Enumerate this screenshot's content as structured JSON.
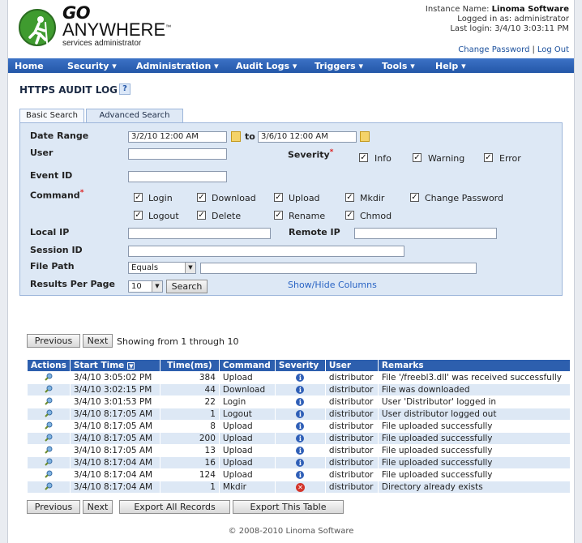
{
  "header": {
    "logo_go": "GO",
    "logo_anywhere": "ANYWHERE",
    "logo_trademark": "™",
    "logo_sub": "services administrator",
    "instance_label": "Instance Name:",
    "instance_name": "Linoma Software",
    "logged_in": "Logged in as: administrator",
    "last_login": "Last login: 3/4/10 3:03:11 PM",
    "change_password": "Change Password",
    "logout": "Log Out",
    "separator": "|"
  },
  "nav": {
    "items": [
      {
        "label": "Home"
      },
      {
        "label": "Security ▾"
      },
      {
        "label": "Administration ▾"
      },
      {
        "label": "Audit Logs ▾"
      },
      {
        "label": "Triggers ▾"
      },
      {
        "label": "Tools ▾"
      },
      {
        "label": "Help ▾"
      }
    ]
  },
  "page": {
    "title": "HTTPS AUDIT LOG",
    "help": "?"
  },
  "tabs": {
    "basic": "Basic Search",
    "advanced": "Advanced Search"
  },
  "search": {
    "date_range_label": "Date Range",
    "date_from": "3/2/10 12:00 AM",
    "to_label": "to",
    "date_to": "3/6/10 12:00 AM",
    "user_label": "User",
    "user_value": "",
    "severity_label": "Severity",
    "required_mark": "*",
    "severity_options": [
      {
        "label": "Info",
        "checked": true
      },
      {
        "label": "Warning",
        "checked": true
      },
      {
        "label": "Error",
        "checked": true
      }
    ],
    "event_id_label": "Event ID",
    "event_id_value": "",
    "command_label": "Command",
    "commands_row1": [
      {
        "label": "Login",
        "checked": true
      },
      {
        "label": "Download",
        "checked": true
      },
      {
        "label": "Upload",
        "checked": true
      },
      {
        "label": "Mkdir",
        "checked": true
      },
      {
        "label": "Change Password",
        "checked": true
      }
    ],
    "commands_row2": [
      {
        "label": "Logout",
        "checked": true
      },
      {
        "label": "Delete",
        "checked": true
      },
      {
        "label": "Rename",
        "checked": true
      },
      {
        "label": "Chmod",
        "checked": true
      }
    ],
    "local_ip_label": "Local IP",
    "local_ip_value": "",
    "remote_ip_label": "Remote IP",
    "remote_ip_value": "",
    "session_id_label": "Session ID",
    "session_id_value": "",
    "file_path_label": "File Path",
    "file_path_match": "Equals",
    "file_path_value": "",
    "results_per_page_label": "Results Per Page",
    "results_per_page": "10",
    "search_button": "Search",
    "show_hide_columns": "Show/Hide Columns"
  },
  "pager_top": {
    "previous": "Previous",
    "next": "Next",
    "showing": "Showing from 1 through 10"
  },
  "table": {
    "columns": [
      "Actions",
      "Start Time",
      "Time(ms)",
      "Command",
      "Severity",
      "User",
      "Remarks"
    ],
    "rows": [
      {
        "start": "3/4/10 3:05:02 PM",
        "ms": "384",
        "command": "Upload",
        "severity": "info",
        "user": "distributor",
        "remarks": "File '/freebl3.dll' was received successfully"
      },
      {
        "start": "3/4/10 3:02:15 PM",
        "ms": "44",
        "command": "Download",
        "severity": "info",
        "user": "distributor",
        "remarks": "File was downloaded"
      },
      {
        "start": "3/4/10 3:01:53 PM",
        "ms": "22",
        "command": "Login",
        "severity": "info",
        "user": "distributor",
        "remarks": "User 'Distributor' logged in"
      },
      {
        "start": "3/4/10 8:17:05 AM",
        "ms": "1",
        "command": "Logout",
        "severity": "info",
        "user": "distributor",
        "remarks": "User distributor logged out"
      },
      {
        "start": "3/4/10 8:17:05 AM",
        "ms": "8",
        "command": "Upload",
        "severity": "info",
        "user": "distributor",
        "remarks": "File uploaded successfully"
      },
      {
        "start": "3/4/10 8:17:05 AM",
        "ms": "200",
        "command": "Upload",
        "severity": "info",
        "user": "distributor",
        "remarks": "File uploaded successfully"
      },
      {
        "start": "3/4/10 8:17:05 AM",
        "ms": "13",
        "command": "Upload",
        "severity": "info",
        "user": "distributor",
        "remarks": "File uploaded successfully"
      },
      {
        "start": "3/4/10 8:17:04 AM",
        "ms": "16",
        "command": "Upload",
        "severity": "info",
        "user": "distributor",
        "remarks": "File uploaded successfully"
      },
      {
        "start": "3/4/10 8:17:04 AM",
        "ms": "124",
        "command": "Upload",
        "severity": "info",
        "user": "distributor",
        "remarks": "File uploaded successfully"
      },
      {
        "start": "3/4/10 8:17:04 AM",
        "ms": "1",
        "command": "Mkdir",
        "severity": "error",
        "user": "distributor",
        "remarks": "Directory already exists"
      }
    ]
  },
  "pager_bottom": {
    "previous": "Previous",
    "next": "Next",
    "export_all": "Export All Records",
    "export_table": "Export This Table"
  },
  "footer": {
    "copyright": "© 2008-2010 Linoma Software"
  },
  "colors": {
    "nav": "#2d5fae",
    "panel": "#dde8f5",
    "link": "#2a64c4",
    "logo_green": "#3f9b2f",
    "error": "#d3352b"
  }
}
